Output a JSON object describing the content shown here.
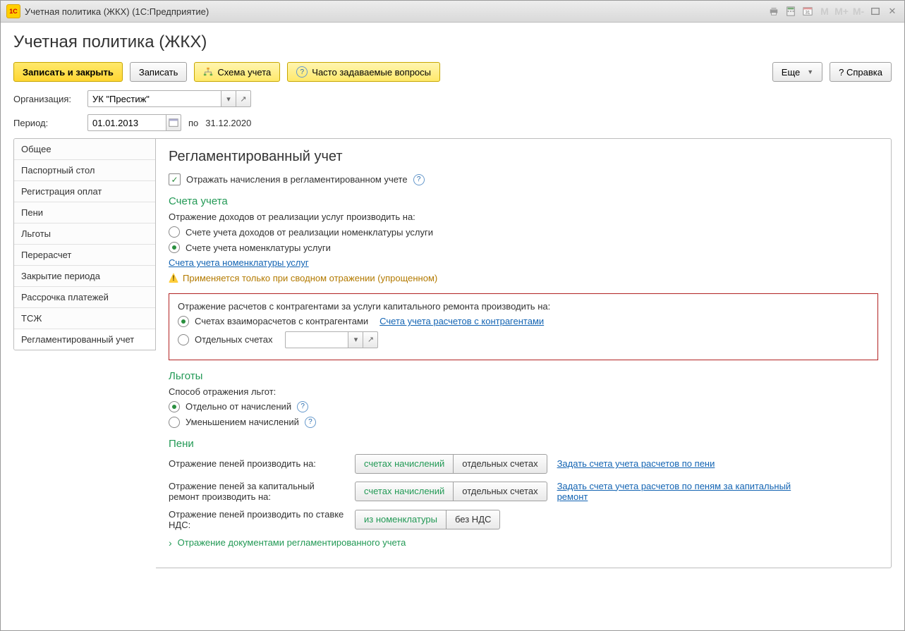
{
  "window": {
    "title": "Учетная политика (ЖКХ)  (1С:Предприятие)"
  },
  "page": {
    "title": "Учетная политика (ЖКХ)"
  },
  "toolbar": {
    "save_close": "Записать и закрыть",
    "save": "Записать",
    "scheme": "Схема учета",
    "faq": "Часто задаваемые вопросы",
    "more": "Еще",
    "help": "?  Справка"
  },
  "fields": {
    "org_label": "Организация:",
    "org_value": "УК \"Престиж\"",
    "period_label": "Период:",
    "period_from": "01.01.2013",
    "po": "по",
    "period_to": "31.12.2020"
  },
  "sidebar": {
    "items": [
      "Общее",
      "Паспортный стол",
      "Регистрация оплат",
      "Пени",
      "Льготы",
      "Перерасчет",
      "Закрытие периода",
      "Рассрочка платежей",
      "ТСЖ",
      "Регламентированный учет"
    ],
    "active_index": 9
  },
  "panel": {
    "heading": "Регламентированный учет",
    "reflect_checkbox": "Отражать начисления в регламентированном учете",
    "section_accounts": "Счета учета",
    "income_label": "Отражение доходов от реализации услуг производить на:",
    "income_r1": "Счете учета доходов от реализации номенклатуры услуги",
    "income_r2": "Счете учета номенклатуры услуги",
    "link_nomenclature": "Счета учета номенклатуры услуг",
    "warn_text": "Применяется только при сводном отражении (упрощенном)",
    "redbox": {
      "settlements_label": "Отражение расчетов с контрагентами за услуги капитального ремонта производить на:",
      "r1": "Счетах взаиморасчетов с контрагентами",
      "r1_link": "Счета учета расчетов с контрагентами",
      "r2": "Отдельных счетах"
    },
    "section_benefits": "Льготы",
    "benefits_label": "Способ отражения льгот:",
    "ben_r1": "Отдельно от начислений",
    "ben_r2": "Уменьшением начислений",
    "section_peni": "Пени",
    "peni_row1_label": "Отражение пеней производить на:",
    "peni_row2_label": "Отражение пеней за капитальный ремонт производить на:",
    "peni_row3_label": "Отражение пеней производить по ставке НДС:",
    "seg_charges": "счетах начислений",
    "seg_separate": "отдельных счетах",
    "seg_from_nom": "из номенклатуры",
    "seg_no_vat": "без НДС",
    "peni_link1": "Задать счета учета расчетов по пени",
    "peni_link2": "Задать счета учета расчетов по пеням за капитальный ремонт",
    "expand": "Отражение документами регламентированного учета"
  }
}
